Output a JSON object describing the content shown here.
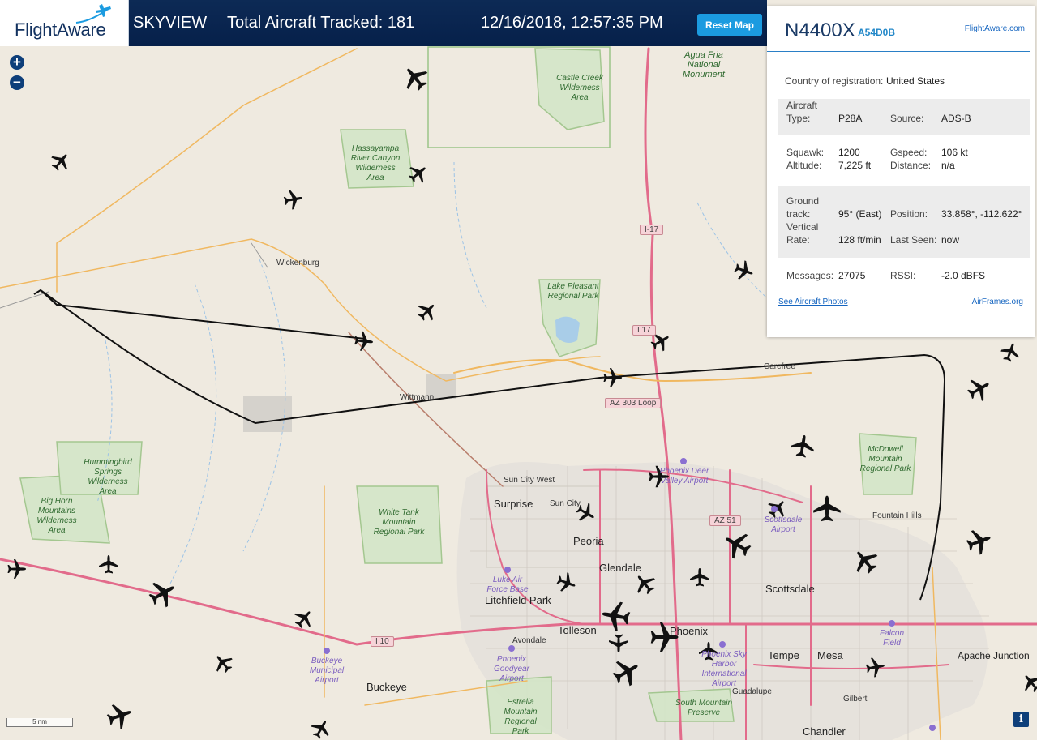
{
  "header": {
    "logo_text": "FlightAware",
    "app_name": "SKYVIEW",
    "tracked": "Total Aircraft Tracked: 181",
    "datetime": "12/16/2018, 12:57:35 PM",
    "reset_label": "Reset Map"
  },
  "map_controls": {
    "zoom_in": "+",
    "zoom_out": "−",
    "scale": "5 nm",
    "info": "i"
  },
  "panel": {
    "registration": "N4400X",
    "hex": "A54D0B",
    "fa_link": "FlightAware.com",
    "country_label": "Country of registration:",
    "country_value": "United States",
    "type_label": "Aircraft Type:",
    "type_value": "P28A",
    "source_label": "Source:",
    "source_value": "ADS-B",
    "squawk_label": "Squawk:",
    "squawk_value": "1200",
    "altitude_label": "Altitude:",
    "altitude_value": "7,225 ft",
    "gspeed_label": "Gspeed:",
    "gspeed_value": "106 kt",
    "distance_label": "Distance:",
    "distance_value": "n/a",
    "track_label": "Ground track:",
    "track_value": "95° (East)",
    "position_label": "Position:",
    "position_value": "33.858°, -112.622°",
    "vrate_label": "Vertical Rate:",
    "vrate_value": "128 ft/min",
    "lastseen_label": "Last Seen:",
    "lastseen_value": "now",
    "messages_label": "Messages:",
    "messages_value": "27075",
    "rssi_label": "RSSI:",
    "rssi_value": "-2.0 dBFS",
    "photos_link": "See Aircraft Photos",
    "airframes_link": "AirFrames.org"
  },
  "map_labels": {
    "agua_fria": "Agua Fria National Monument",
    "castle_creek": "Castle Creek Wilderness Area",
    "hassayampa": "Hassayampa River Canyon Wilderness Area",
    "wickenburg": "Wickenburg",
    "lake_pleasant": "Lake Pleasant Regional Park",
    "carefree": "Carefree",
    "wittmann": "Wittmann",
    "mcdowell": "McDowell Mountain Regional Park",
    "hummingbird": "Hummingbird Springs Wilderness Area",
    "big_horn": "Big Horn Mountains Wilderness Area",
    "white_tank": "White Tank Mountain Regional Park",
    "sun_city_west": "Sun City West",
    "surprise": "Surprise",
    "sun_city": "Sun City",
    "peoria": "Peoria",
    "glendale": "Glendale",
    "litchfield": "Litchfield Park",
    "tolleson": "Tolleson",
    "avondale": "Avondale",
    "buckeye": "Buckeye",
    "phoenix": "Phoenix",
    "scottsdale": "Scottsdale",
    "tempe": "Tempe",
    "mesa": "Mesa",
    "fountain_hills": "Fountain Hills",
    "apache_junction": "Apache Junction",
    "gilbert": "Gilbert",
    "chandler": "Chandler",
    "guadalupe": "Guadalupe",
    "estrella": "Estrella Mountain Regional Park",
    "south_mountain": "South Mountain Preserve",
    "deer_valley": "Phoenix Deer Valley Airport",
    "scottsdale_airport": "Scottsdale Airport",
    "luke": "Luke Air Force Base",
    "buckeye_airport": "Buckeye Municipal Airport",
    "goodyear": "Phoenix Goodyear Airport",
    "sky_harbor": "Phoenix Sky Harbor International Airport",
    "falcon": "Falcon Field",
    "i17_a": "I-17",
    "i17_b": "I 17",
    "az303": "AZ 303 Loop",
    "az51": "AZ 51",
    "i10": "I 10"
  }
}
